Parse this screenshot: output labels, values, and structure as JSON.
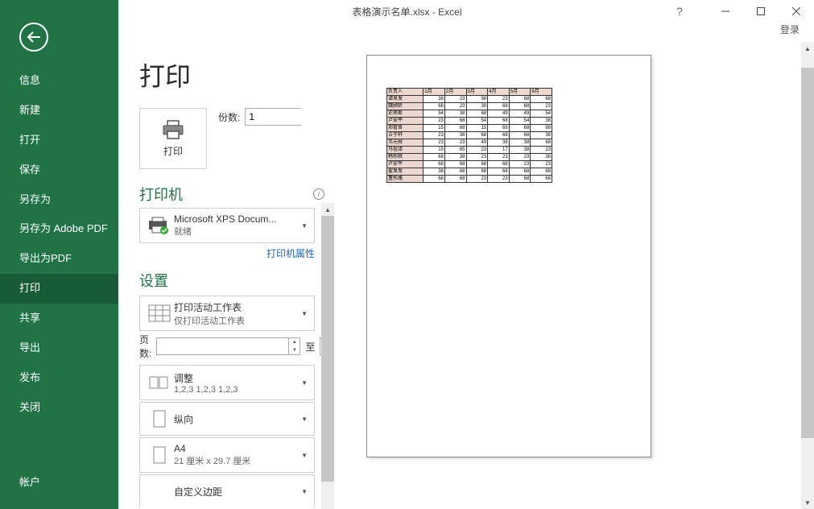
{
  "titlebar": {
    "title": "表格演示名单.xlsx - Excel"
  },
  "login": "登录",
  "sidebar": {
    "items": [
      "信息",
      "新建",
      "打开",
      "保存",
      "另存为",
      "另存为 Adobe PDF",
      "导出为PDF",
      "打印",
      "共享",
      "导出",
      "发布",
      "关闭"
    ],
    "account": "帐户",
    "active_index": 7
  },
  "page": {
    "title": "打印",
    "print_label": "打印",
    "copies_label": "份数:",
    "copies_value": "1"
  },
  "printer": {
    "section": "打印机",
    "name": "Microsoft XPS Docum...",
    "status": "就绪",
    "properties": "打印机属性"
  },
  "settings": {
    "section": "设置",
    "active": {
      "title": "打印活动工作表",
      "sub": "仅打印活动工作表"
    },
    "pages_label": "页数:",
    "to_label": "至",
    "collate": {
      "title": "调整",
      "sub": "1,2,3    1,2,3    1,2,3"
    },
    "orientation": {
      "title": "纵向",
      "sub": ""
    },
    "paper": {
      "title": "A4",
      "sub": "21 厘米 x 29.7 厘米"
    },
    "margins": {
      "title": "自定义边距",
      "sub": ""
    }
  },
  "chart_data": {
    "type": "table",
    "title": "",
    "headers": [
      "负责人",
      "1月",
      "2月",
      "3月",
      "4月",
      "5月",
      "6月"
    ],
    "rows": [
      [
        "谭发发",
        38,
        23,
        98,
        23,
        68,
        68
      ],
      [
        "魏顾昕",
        68,
        23,
        39,
        68,
        68,
        23
      ],
      [
        "史密斯",
        54,
        38,
        68,
        49,
        49,
        54
      ],
      [
        "卢安平",
        23,
        68,
        54,
        68,
        54,
        38
      ],
      [
        "郑管晋",
        15,
        68,
        15,
        68,
        68,
        68
      ],
      [
        "占于轩",
        23,
        38,
        68,
        68,
        68,
        38
      ],
      [
        "韦元舜",
        23,
        23,
        49,
        38,
        38,
        68
      ],
      [
        "马祖译",
        15,
        65,
        23,
        17,
        38,
        23
      ],
      [
        "韩彤轶",
        68,
        38,
        23,
        23,
        23,
        38
      ],
      [
        "卢安平",
        68,
        68,
        68,
        68,
        23,
        23
      ],
      [
        "翟发发",
        38,
        68,
        68,
        68,
        68,
        68
      ],
      [
        "董彤路",
        68,
        68,
        23,
        23,
        68,
        68
      ]
    ]
  }
}
